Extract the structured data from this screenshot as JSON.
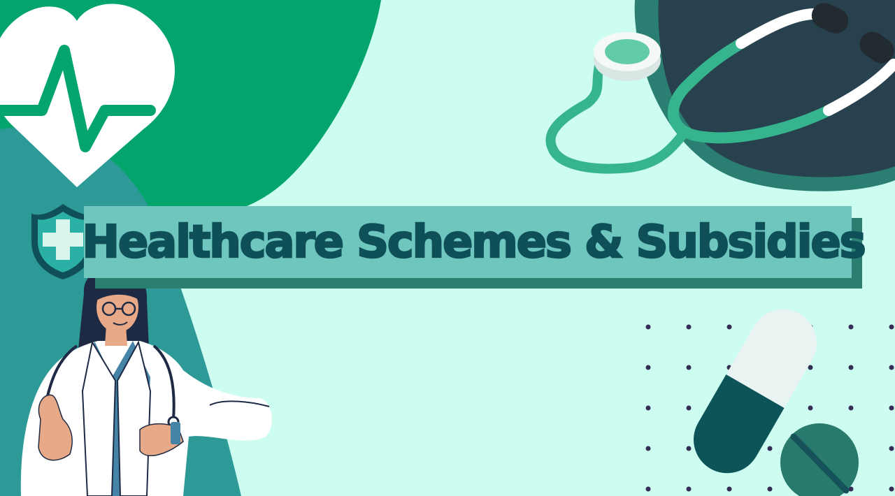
{
  "banner": {
    "title": "Healthcare Schemes & Subsidies"
  },
  "icons": [
    "heart-pulse-icon",
    "stethoscope-icon",
    "shield-cross-icon",
    "capsule-icon",
    "tablet-pill-icon",
    "doctor-illustration"
  ],
  "colors": {
    "background": "#cdfdf1",
    "green_blob": "#04a56c",
    "teal_blob": "#2e9a98",
    "navy_blob": "#27414f",
    "banner_fill": "#6fc6bf",
    "banner_shadow": "#2a7f70",
    "title_text": "#0f4f58",
    "dot": "#342d55"
  }
}
